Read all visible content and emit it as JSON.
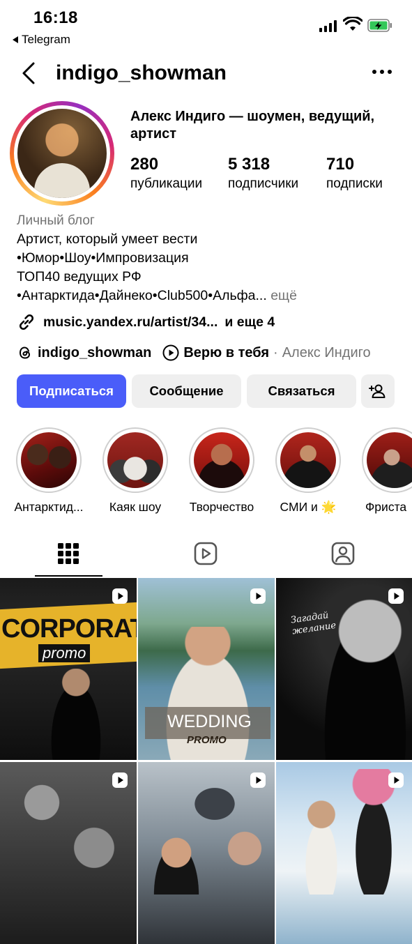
{
  "status_bar": {
    "time": "16:18",
    "back_app": "Telegram"
  },
  "header": {
    "username": "indigo_showman",
    "back_icon": "chevron-left-icon",
    "more_icon": "more-horizontal-icon"
  },
  "profile": {
    "full_name": "Алекс Индиго — шоумен, ведущий, артист",
    "stats": [
      {
        "value": "280",
        "label": "публикации"
      },
      {
        "value": "5 318",
        "label": "подписчики"
      },
      {
        "value": "710",
        "label": "подписки"
      }
    ],
    "category": "Личный блог",
    "bio_lines": [
      "Артист, который умеет вести",
      "•Юмор•Шоу•Импровизация",
      "ТОП40 ведущих РФ",
      "•Антарктида•Дайнеко•Club500•Альфа..."
    ],
    "bio_more": "ещё",
    "link": "music.yandex.ru/artist/34...",
    "link_more": "и еще 4",
    "threads_handle": "indigo_showman",
    "music_title": "Верю в тебя",
    "music_separator": "·",
    "music_artist": "Алекс Индиго"
  },
  "buttons": {
    "follow": "Подписаться",
    "message": "Сообщение",
    "contact": "Связаться",
    "add_user_icon": "person-add-icon"
  },
  "highlights": [
    {
      "label": "Антарктид..."
    },
    {
      "label": "Каяк шоу"
    },
    {
      "label": "Творчество"
    },
    {
      "label": "СМИ и 🌟"
    },
    {
      "label": "Фриста"
    }
  ],
  "tabs": [
    {
      "icon": "grid-icon",
      "active": true
    },
    {
      "icon": "reels-icon",
      "active": false
    },
    {
      "icon": "tagged-icon",
      "active": false
    }
  ],
  "posts": [
    {
      "text_main": "CORPORATE",
      "text_sub": "promo"
    },
    {
      "text_main": "WEDDING",
      "text_sub": "PROMO"
    },
    {
      "text_main": "Загадай желание",
      "text_sub": ""
    },
    {
      "text_main": "",
      "text_sub": ""
    },
    {
      "text_main": "",
      "text_sub": ""
    },
    {
      "text_main": "",
      "text_sub": ""
    }
  ],
  "colors": {
    "follow_button": "#4a5df9",
    "secondary_text": "#737373",
    "button_bg": "#efefef"
  }
}
